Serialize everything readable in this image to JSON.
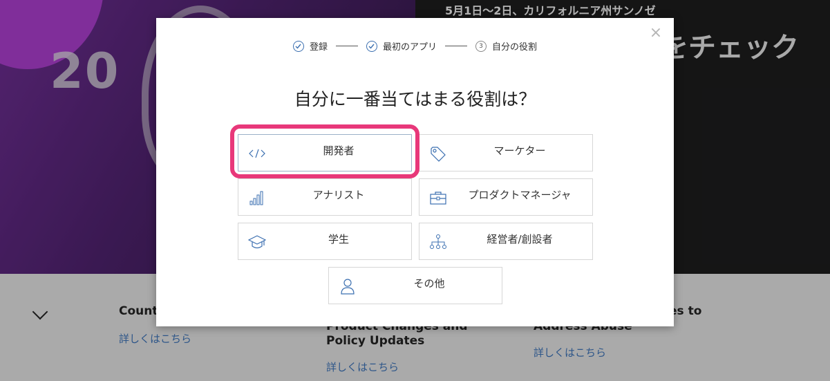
{
  "background": {
    "hero_number": "20",
    "event_date": "5月1日〜2日、カリフォルニア州サンノゼ",
    "hero_heading_fragment": "をチェック",
    "cards": [
      {
        "title": "Count",
        "link": "詳しくはこちら"
      },
      {
        "title": "Product Changes and Policy Updates",
        "link": "詳しくはこちら"
      },
      {
        "title": "Address Abuse",
        "title_right": "es to",
        "link": "詳しくはこちら"
      }
    ]
  },
  "modal": {
    "steps": [
      {
        "label": "登録",
        "state": "done"
      },
      {
        "label": "最初のアプリ",
        "state": "done"
      },
      {
        "label": "自分の役割",
        "state": "current",
        "number": "3"
      }
    ],
    "question": "自分に一番当てはまる役割は？",
    "roles": [
      {
        "label": "開発者",
        "icon": "code-icon"
      },
      {
        "label": "マーケター",
        "icon": "tag-icon"
      },
      {
        "label": "アナリスト",
        "icon": "bar-chart-icon"
      },
      {
        "label": "プロダクトマネージャ",
        "icon": "briefcase-icon"
      },
      {
        "label": "学生",
        "icon": "graduation-cap-icon"
      },
      {
        "label": "経営者/創設者",
        "icon": "org-chart-icon"
      },
      {
        "label": "その他",
        "icon": "user-icon"
      }
    ],
    "close_glyph": "×"
  },
  "colors": {
    "accent": "#3b6fb0",
    "highlight": "#e8387a",
    "hero_purple": "#6a2c8e",
    "hero_dark": "#1b1b1c"
  }
}
